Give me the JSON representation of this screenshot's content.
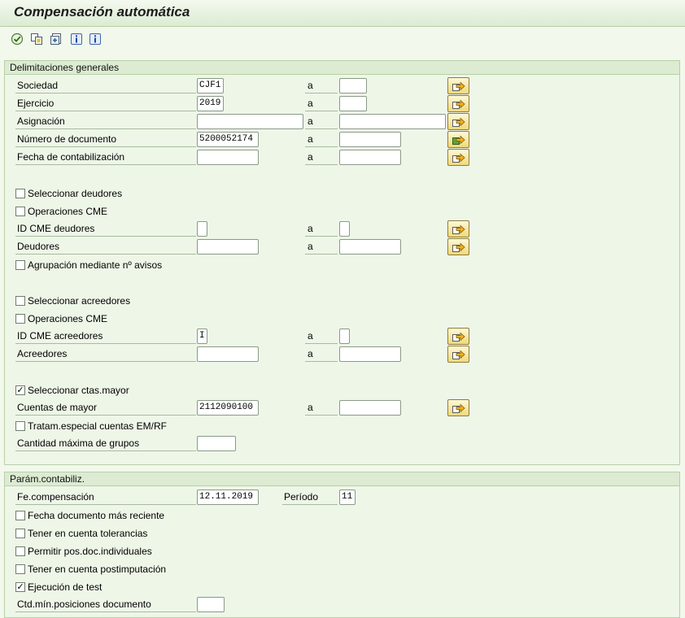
{
  "title": "Compensación automática",
  "toolbar": {
    "icons": [
      "execute-icon",
      "copy-variant-icon",
      "get-variant-icon",
      "info-icon",
      "info-icon-2"
    ]
  },
  "general": {
    "header": "Delimitaciones generales",
    "range_sep": "a",
    "sociedad": {
      "label": "Sociedad",
      "from": "CJF1",
      "to": ""
    },
    "ejercicio": {
      "label": "Ejercicio",
      "from": "2019",
      "to": ""
    },
    "asignacion": {
      "label": "Asignación",
      "from": "",
      "to": ""
    },
    "numero_documento": {
      "label": "Número de documento",
      "from": "5200052174",
      "to": ""
    },
    "fecha_contabilizacion": {
      "label": "Fecha de contabilización",
      "from": "",
      "to": ""
    },
    "sel_deudores": {
      "label": "Seleccionar deudores",
      "checked": false
    },
    "op_cme_deudores": {
      "label": "Operaciones CME",
      "checked": false
    },
    "id_cme_deudores": {
      "label": "ID CME deudores",
      "from": "",
      "to": ""
    },
    "deudores": {
      "label": "Deudores",
      "from": "",
      "to": ""
    },
    "agrupacion_avisos": {
      "label": "Agrupación mediante nº avisos",
      "checked": false
    },
    "sel_acreedores": {
      "label": "Seleccionar acreedores",
      "checked": false
    },
    "op_cme_acreedores": {
      "label": "Operaciones CME",
      "checked": false
    },
    "id_cme_acreedores": {
      "label": "ID CME acreedores",
      "from": "I",
      "to": ""
    },
    "acreedores": {
      "label": "Acreedores",
      "from": "",
      "to": ""
    },
    "sel_ctas_mayor": {
      "label": "Seleccionar ctas.mayor",
      "checked": true
    },
    "cuentas_mayor": {
      "label": "Cuentas de mayor",
      "from": "2112090100",
      "to": ""
    },
    "tratam_especial": {
      "label": "Tratam.especial cuentas EM/RF",
      "checked": false
    },
    "cantidad_max_grupos": {
      "label": "Cantidad máxima de grupos",
      "value": ""
    }
  },
  "posting": {
    "header": "Parám.contabiliz.",
    "fe_compensacion": {
      "label": "Fe.compensación",
      "value": "12.11.2019"
    },
    "periodo": {
      "label": "Período",
      "value": "11"
    },
    "fecha_doc_reciente": {
      "label": "Fecha documento más reciente",
      "checked": false
    },
    "tolerancias": {
      "label": "Tener en cuenta tolerancias",
      "checked": false
    },
    "pos_doc_individuales": {
      "label": "Permitir pos.doc.individuales",
      "checked": false
    },
    "postimputacion": {
      "label": "Tener en cuenta postimputación",
      "checked": false
    },
    "ejecucion_test": {
      "label": "Ejecución de test",
      "checked": true
    },
    "ctd_min_posiciones": {
      "label": "Ctd.mín.posiciones documento",
      "value": ""
    }
  },
  "colors": {
    "accent_yellow": "#f0d97a",
    "panel_green": "#dcebd2",
    "background": "#f2f8ec"
  }
}
